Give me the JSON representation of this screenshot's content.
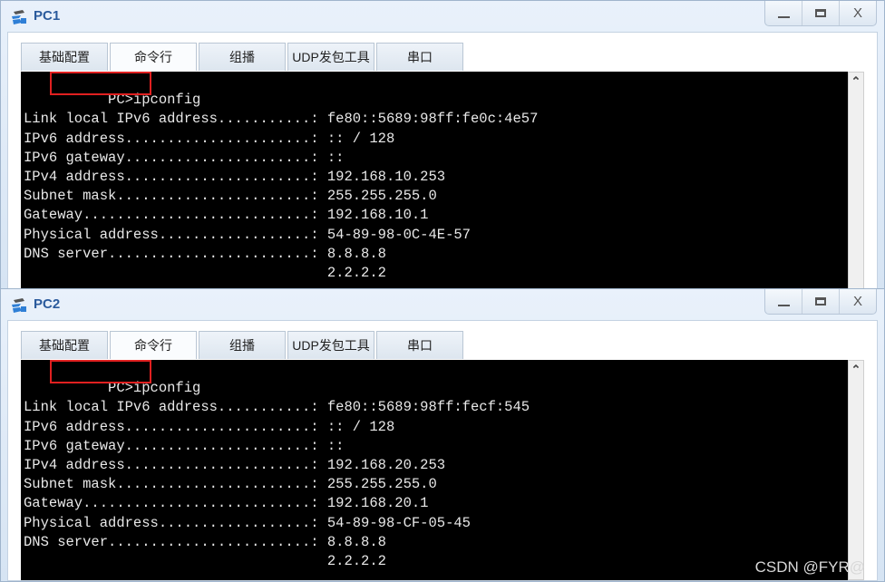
{
  "windows": [
    {
      "title": "PC1",
      "icon": "network-pc-icon",
      "controls": {
        "minimize": "minimize",
        "maximize": "maximize",
        "close": "X"
      },
      "tabs": [
        "基础配置",
        "命令行",
        "组播",
        "UDP发包工具",
        "串口"
      ],
      "active_tab": "命令行",
      "terminal": {
        "prompt": "PC>",
        "command": "ipconfig",
        "lines": [
          "",
          "Link local IPv6 address...........: fe80::5689:98ff:fe0c:4e57",
          "IPv6 address......................: :: / 128",
          "IPv6 gateway......................: ::",
          "IPv4 address......................: 192.168.10.253",
          "Subnet mask.......................: 255.255.255.0",
          "Gateway...........................: 192.168.10.1",
          "Physical address..................: 54-89-98-0C-4E-57",
          "DNS server........................: 8.8.8.8",
          "                                    2.2.2.2"
        ]
      }
    },
    {
      "title": "PC2",
      "icon": "network-pc-icon",
      "controls": {
        "minimize": "minimize",
        "maximize": "maximize",
        "close": "X"
      },
      "tabs": [
        "基础配置",
        "命令行",
        "组播",
        "UDP发包工具",
        "串口"
      ],
      "active_tab": "命令行",
      "terminal": {
        "prompt": "PC>",
        "command": "ipconfig",
        "lines": [
          "",
          "Link local IPv6 address...........: fe80::5689:98ff:fecf:545",
          "IPv6 address......................: :: / 128",
          "IPv6 gateway......................: ::",
          "IPv4 address......................: 192.168.20.253",
          "Subnet mask.......................: 255.255.255.0",
          "Gateway...........................: 192.168.20.1",
          "Physical address..................: 54-89-98-CF-05-45",
          "DNS server........................: 8.8.8.8",
          "                                    2.2.2.2"
        ]
      }
    }
  ],
  "watermark": "CSDN @FYR@",
  "colors": {
    "highlight_box": "#e02020",
    "title_text": "#2a5a9c",
    "terminal_bg": "#000000"
  }
}
